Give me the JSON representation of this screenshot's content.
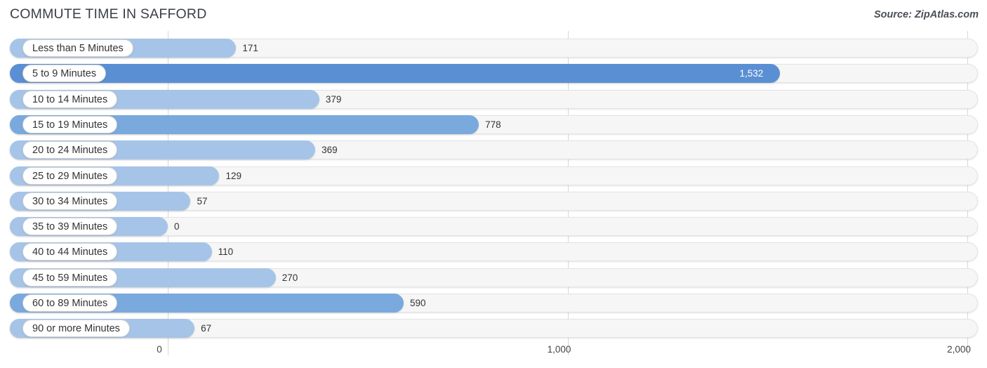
{
  "header": {
    "title": "COMMUTE TIME IN SAFFORD",
    "source": "Source: ZipAtlas.com"
  },
  "colors": {
    "bar_light": "#a6c4e7",
    "bar_mid": "#7aa9de",
    "bar_accent": "#5b8fd4",
    "track": "#f6f6f6",
    "gridline": "#d8d8d8",
    "text": "#333333"
  },
  "chart_data": {
    "type": "bar",
    "orientation": "horizontal",
    "title": "COMMUTE TIME IN SAFFORD",
    "subtitle": "",
    "xlabel": "",
    "ylabel": "",
    "xlim": [
      0,
      2000
    ],
    "grid": true,
    "legend": false,
    "source": "Source: ZipAtlas.com",
    "xticks": [
      "0",
      "1,000",
      "2,000"
    ],
    "xtick_values": [
      0,
      1000,
      2000
    ],
    "categories": [
      "Less than 5 Minutes",
      "5 to 9 Minutes",
      "10 to 14 Minutes",
      "15 to 19 Minutes",
      "20 to 24 Minutes",
      "25 to 29 Minutes",
      "30 to 34 Minutes",
      "35 to 39 Minutes",
      "40 to 44 Minutes",
      "45 to 59 Minutes",
      "60 to 89 Minutes",
      "90 or more Minutes"
    ],
    "values": [
      171,
      1532,
      379,
      778,
      369,
      129,
      57,
      0,
      110,
      270,
      590,
      67
    ],
    "value_labels": [
      "171",
      "1,532",
      "379",
      "778",
      "369",
      "129",
      "57",
      "0",
      "110",
      "270",
      "590",
      "67"
    ],
    "bar_styles": [
      "light",
      "accent",
      "light",
      "mid",
      "light",
      "light",
      "light",
      "light",
      "light",
      "light",
      "mid",
      "light"
    ]
  }
}
